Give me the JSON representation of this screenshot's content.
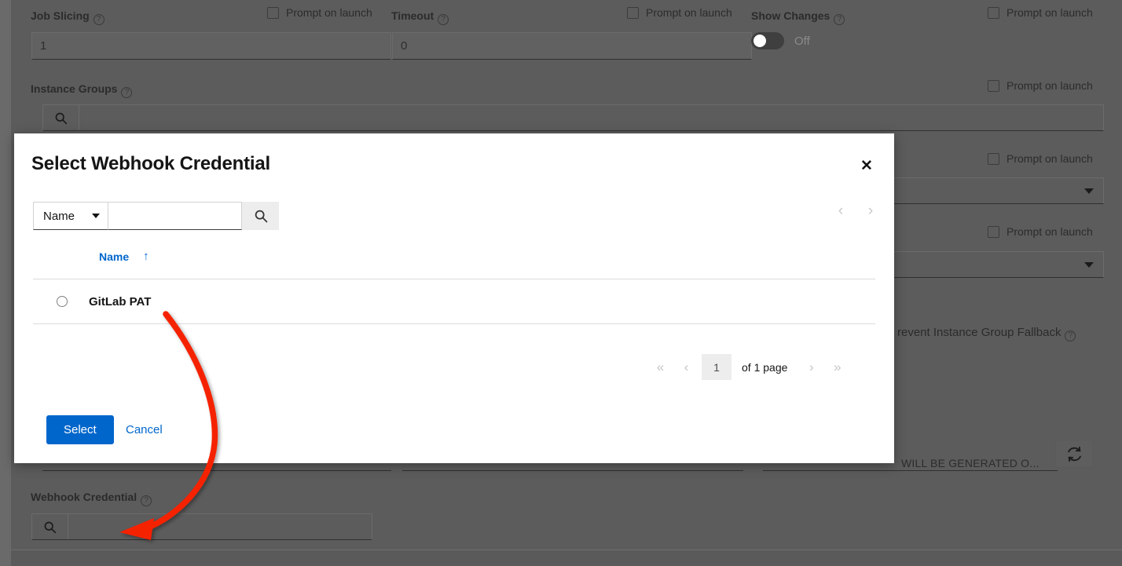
{
  "background": {
    "fields": [
      {
        "label": "Job Slicing",
        "help": "?",
        "value": "1"
      },
      {
        "label": "Timeout",
        "help": "?",
        "value": "0"
      },
      {
        "label": "Show Changes",
        "help": "?",
        "toggle_state": "Off"
      },
      {
        "label": "Instance Groups",
        "help": "?",
        "value": ""
      },
      {
        "label": "Webhook Credential",
        "help": "?",
        "value": ""
      }
    ],
    "prompt_on_launch_label": "Prompt on launch",
    "prevent_fallback_label": "revent Instance Group Fallback",
    "generated_text": "WILL BE GENERATED O...",
    "refresh_icon": "refresh-icon",
    "search_icon": "search-icon",
    "toggle_off_label": "Off"
  },
  "modal": {
    "title": "Select Webhook Credential",
    "close_icon": "close-icon",
    "search": {
      "dropdown_label": "Name",
      "dropdown_icon": "chevron-down-icon",
      "input_value": "",
      "input_placeholder": "",
      "submit_icon": "search-icon"
    },
    "pager_top": {
      "prev_icon": "chevron-left-icon",
      "next_icon": "chevron-right-icon"
    },
    "table": {
      "columns": [
        "Name"
      ],
      "sort_indicator": "↑",
      "rows": [
        {
          "name": "GitLab PAT",
          "selected": false
        }
      ]
    },
    "pager_bottom": {
      "first_icon": "«",
      "prev_icon": "‹",
      "page_number": "1",
      "of_text": "of 1 page",
      "next_icon": "›",
      "last_icon": "»"
    },
    "footer": {
      "select_label": "Select",
      "cancel_label": "Cancel"
    }
  },
  "annotation": {
    "color": "#f52000",
    "shape": "curved-arrow"
  },
  "colors": {
    "accent_blue": "#0066cc",
    "dim_overlay": "#5c5c5c",
    "annotation_red": "#f52000"
  }
}
